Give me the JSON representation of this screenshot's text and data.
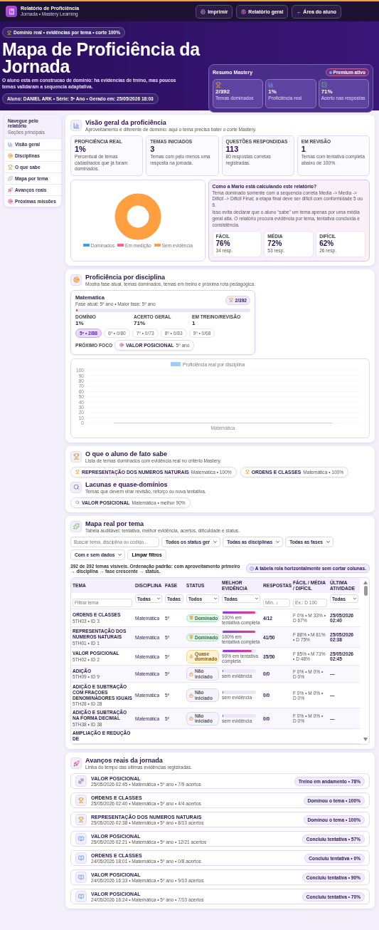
{
  "topbar": {
    "app_title": "Relatório de Proficiência",
    "app_subtitle": "Jornada • Mastery Learning",
    "buttons": [
      {
        "kind": "print",
        "label": "Imprimir"
      },
      {
        "kind": "brain",
        "label": "Relatório geral"
      },
      {
        "kind": "back",
        "label": "← Área do aluno"
      }
    ]
  },
  "hero": {
    "badge": "Domínio real • evidências por tema • corte 100%",
    "title": "Mapa de Proficiência da Jornada",
    "subtitle": "O aluno esta em construcao de dominio: ha evidencias de treino, mas poucos temas validaram a sequencia adaptativa.",
    "student": "Aluno: DANIEL ARK • Série: 5º Ano • Gerado em: 25/05/2026 18:03",
    "summary": {
      "title": "Resumo Mastery",
      "badge": "Premium ativo",
      "stats": [
        {
          "kind": "trophy",
          "value": "2/392",
          "label": "Temas dominados"
        },
        {
          "kind": "chart",
          "value": "1%",
          "label": "Proficiência real"
        },
        {
          "kind": "check",
          "value": "71%",
          "label": "Acerto nas respostas"
        }
      ]
    }
  },
  "nav": {
    "title": "Navegue pelo relatório",
    "subtitle": "Seções principais",
    "items": [
      "Visão geral",
      "Disciplinas",
      "O que sabe",
      "Mapa por tema",
      "Avanços reais",
      "Próximas missões"
    ]
  },
  "overview": {
    "title": "Visão geral da proficiência",
    "description": "Aproveitamento é diferente de domínio: aqui o tema precisa bater o corte Mastery.",
    "stats": [
      {
        "label": "PROFICIÊNCIA REAL",
        "value": "1%",
        "note": "Percentual de temas cadastrados que já foram dominados."
      },
      {
        "label": "TEMAS INICIADOS",
        "value": "3",
        "note": "Temas com pelo menos uma resposta na jornada."
      },
      {
        "label": "QUESTÕES RESPONDIDAS",
        "value": "113",
        "note": "80 respostas corretas registradas."
      },
      {
        "label": "EM REVISÃO",
        "value": "1",
        "note": "Temas com tentativa completa abaixo de 100%."
      }
    ],
    "legend": [
      {
        "label": "Dominados",
        "color": "#36a2eb"
      },
      {
        "label": "Em medição",
        "color": "#ff6384"
      },
      {
        "label": "Sem evidência",
        "color": "#ff9f40"
      }
    ],
    "info": {
      "title": "Como a Mario está calculando este relatório?",
      "paragraphs": [
        "Tema dominado somente com a sequencia correta Media -> Media -> Dificil -> Dificil Final; a etapa final deve ser dificil com conformidade 5 ou 6.",
        "Isso evita declarar que o aluno “sabe” um tema apenas por uma média geral alta. O relatório procura evidência por tema, tentativa concluída e consistência."
      ],
      "levels": [
        {
          "label": "FÁCIL",
          "value": "76%",
          "note": "34 resp."
        },
        {
          "label": "MÉDIA",
          "value": "72%",
          "note": "53 resp."
        },
        {
          "label": "DIFÍCIL",
          "value": "62%",
          "note": "26 resp."
        }
      ]
    }
  },
  "disciplines": {
    "title": "Proficiência por disciplina",
    "description": "Mostra fase atual, temas dominados, temas em treino e próxima rota pedagógica.",
    "card": {
      "name": "Matemática",
      "phase": "Fase atual: 5º ano • Maior fase: 5º ano",
      "badge": "2/392",
      "level": 0.01,
      "stats": [
        {
          "label": "DOMÍNIO",
          "value": "1%"
        },
        {
          "label": "ACERTO GERAL",
          "value": "71%"
        },
        {
          "label": "EM TREINO/REVISÃO",
          "value": "1"
        }
      ],
      "phases": [
        {
          "label": "5º • 2/88",
          "selected": true
        },
        {
          "label": "6º • 0/80",
          "selected": false
        },
        {
          "label": "7º • 0/73",
          "selected": false
        },
        {
          "label": "8º • 0/83",
          "selected": false
        },
        {
          "label": "9º • 0/68",
          "selected": false
        }
      ],
      "next_label": "PRÓXIMO FOCO",
      "next_topic": "VALOR POSICIONAL",
      "next_phase": "5º ano"
    },
    "chart_data": {
      "type": "bar",
      "grid": true,
      "categories": [
        "Matemática"
      ],
      "series": [
        {
          "name": "Proficiência real por disciplina",
          "color": "#9ad0f5",
          "values": [
            1
          ]
        }
      ],
      "ylim": [
        0,
        100
      ],
      "yticks": [
        0,
        10,
        20,
        30,
        40,
        50,
        60,
        70,
        80,
        90,
        100
      ]
    }
  },
  "knows": {
    "title": "O que o aluno de fato sabe",
    "description": "Lista de temas dominados com evidência real no critério Mastery.",
    "items": [
      {
        "topic": "REPRESENTAÇÃO DOS NUMEROS NATURAIS",
        "meta": "Matemática • 100%"
      },
      {
        "topic": "ORDENS E CLASSES",
        "meta": "Matemática • 100%"
      }
    ]
  },
  "gaps": {
    "title": "Lacunas e quase-domínios",
    "description": "Temas que devem virar revisão, reforço ou nova tentativa.",
    "items": [
      {
        "topic": "VALOR POSICIONAL",
        "meta": "Matemática • melhor 90%"
      }
    ]
  },
  "map": {
    "title": "Mapa real por tema",
    "description": "Tabela auditável: tentativa, melhor evidência, acertos, dificuldade e status.",
    "search_placeholder": "Buscar tema, disciplina ou código...",
    "selects": [
      "Todos os status ger",
      "Todas as disciplinas",
      "Todas as fases",
      "Com e sem dados"
    ],
    "clear": "Limpar filtros",
    "count": "392 de 392 temas visíveis. Ordenação padrão: com aproveitamento primeiro → disciplina → fase crescente → status.",
    "hint": "A tabela rola horizontalmente sem cortar colunas.",
    "columns": [
      "TEMA",
      "DISCIPLINA",
      "FASE",
      "STATUS",
      "MELHOR EVIDÊNCIA",
      "RESPOSTAS",
      "FÁCIL / MÉDIA / DIFÍCIL",
      "ÚLTIMA ATIVIDADE"
    ],
    "filters": [
      {
        "kind": "input",
        "placeholder": "Filtrar tema"
      },
      {
        "kind": "select",
        "value": "Todas"
      },
      {
        "kind": "select",
        "value": "Todas"
      },
      {
        "kind": "select",
        "value": "Todos"
      },
      {
        "kind": "select",
        "value": "Todas"
      },
      {
        "kind": "input",
        "placeholder": "Mín. ↕"
      },
      {
        "kind": "input",
        "placeholder": "Ex.: D 100"
      },
      {
        "kind": "select",
        "value": "Todas"
      }
    ],
    "rows": [
      {
        "topic": "ORDENS E CLASSES",
        "code": "5TH03 • ID 3",
        "discipline": "Matemática",
        "phase": "5º",
        "status": {
          "kind": "dominado",
          "label": "Dominado"
        },
        "level": 1,
        "evidence": "100% em tentativa completa",
        "answers": "4/12",
        "split": "F 0% • M 33% • D 67%",
        "last": "25/05/2026 02:40"
      },
      {
        "topic": "REPRESENTAÇÃO DOS NUMEROS NATURAIS",
        "code": "5TH01 • ID 1",
        "discipline": "Matemática",
        "phase": "5º",
        "status": {
          "kind": "dominado",
          "label": "Dominado"
        },
        "level": 1,
        "evidence": "100% em tentativa completa",
        "answers": "41/50",
        "split": "F 88% • M 81% • D 75%",
        "last": "25/05/2026 02:38"
      },
      {
        "topic": "VALOR POSICIONAL",
        "code": "5TH02 • ID 2",
        "discipline": "Matemática",
        "phase": "5º",
        "status": {
          "kind": "quase",
          "label": "Quase dominado"
        },
        "level": 0.9,
        "evidence": "90% em tentativa completa",
        "answers": "35/50",
        "split": "F 85% • M 73% • D 48%",
        "last": "25/05/2026 02:45"
      },
      {
        "topic": "ADIÇÃO",
        "code": "5TH09 • ID 9",
        "discipline": "Matemática",
        "phase": "5º",
        "status": {
          "kind": "nao",
          "label": "Não iniciado"
        },
        "level": 0,
        "evidence": "sem evidência",
        "answers": "0/0",
        "split": "F 0% • M 0% • D 0%",
        "last": "—"
      },
      {
        "topic": "ADIÇÃO E SUBTRAÇÃO COM FRAÇOES DENOMINADORES IGUAIS",
        "code": "5TH28 • ID 28",
        "discipline": "Matemática",
        "phase": "5º",
        "status": {
          "kind": "nao",
          "label": "Não iniciado"
        },
        "level": 0,
        "evidence": "sem evidência",
        "answers": "0/0",
        "split": "F 0% • M 0% • D 0%",
        "last": "—"
      },
      {
        "topic": "ADIÇÃO E SUBTRAÇÃO NA FORMA DECIMAL",
        "code": "5TH38 • ID 38",
        "discipline": "Matemática",
        "phase": "5º",
        "status": {
          "kind": "nao",
          "label": "Não iniciado"
        },
        "level": 0,
        "evidence": "sem evidência",
        "answers": "0/0",
        "split": "F 0% • M 0% • D 0%",
        "last": "—"
      },
      {
        "topic": "AMPLIAÇÃO E REDUÇÃO DE"
      }
    ]
  },
  "progress": {
    "title": "Avanços reais da jornada",
    "description": "Linha do tempo das últimas evidências registradas.",
    "items": [
      {
        "kind": "treino",
        "topic": "VALOR POSICIONAL",
        "meta": "25/05/2026 02:45 • Matemática • 5º ano • 7/9 acertos",
        "badge": "Treino em andamento • 78%"
      },
      {
        "kind": "dominou",
        "topic": "ORDENS E CLASSES",
        "meta": "25/05/2026 02:40 • Matemática • 5º ano • 4/4 acertos",
        "badge": "Dominou o tema • 100%"
      },
      {
        "kind": "dominou",
        "topic": "REPRESENTAÇÃO DOS NUMEROS NATURAIS",
        "meta": "25/05/2026 02:38 • Matemática • 5º ano • 8/10 acertos",
        "badge": "Dominou o tema • 100%"
      },
      {
        "kind": "tentativa",
        "topic": "VALOR POSICIONAL",
        "meta": "25/05/2026 02:21 • Matemática • 5º ano • 12/21 acertos",
        "badge": "Concluiu tentativa • 57%"
      },
      {
        "kind": "tentativa",
        "topic": "ORDENS E CLASSES",
        "meta": "24/05/2026 18:01 • Matemática • 5º ano • 0/8 acertos",
        "badge": "Concluiu tentativa • 0%"
      },
      {
        "kind": "tentativa",
        "topic": "VALOR POSICIONAL",
        "meta": "24/05/2026 16:33 • Matemática • 5º ano • 9/10 acertos",
        "badge": "Concluiu tentativa • 90%"
      },
      {
        "kind": "tentativa",
        "topic": "VALOR POSICIONAL",
        "meta": "24/05/2026 16:24 • Matemática • 5º ano • 7/10 acertos",
        "badge": "Concluiu tentativa • 70%"
      }
    ]
  }
}
